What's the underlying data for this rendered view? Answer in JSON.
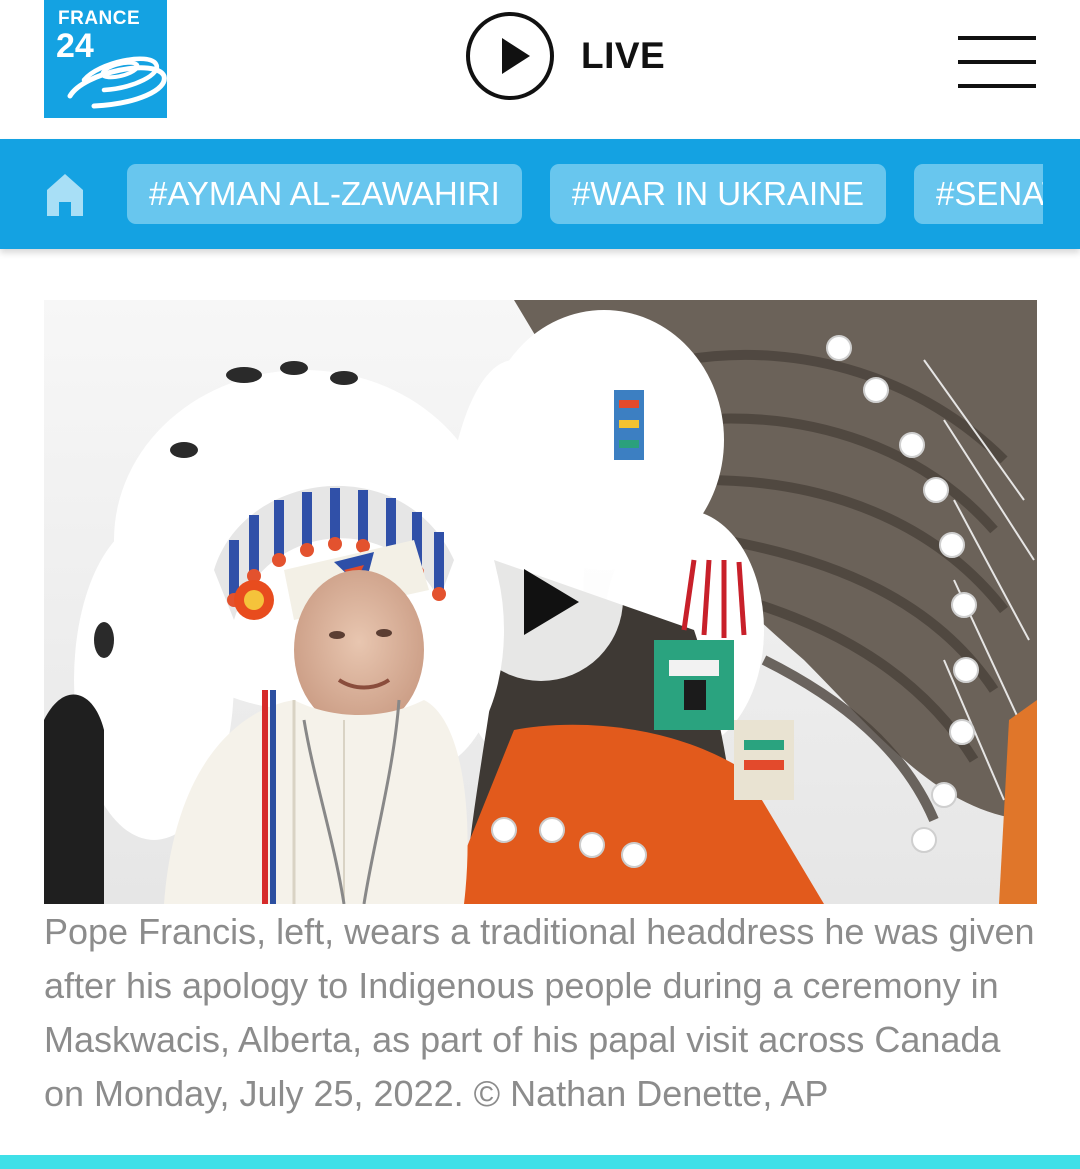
{
  "header": {
    "logo": {
      "name": "FRANCE",
      "number": "24"
    },
    "live_label": "LIVE",
    "menu_icon": "hamburger-menu-icon",
    "colors": {
      "brand": "#14a2e2"
    }
  },
  "tagbar": {
    "home_icon": "home-icon",
    "tags": [
      {
        "label": "#AYMAN AL-ZAWAHIRI"
      },
      {
        "label": "#WAR IN UKRAINE"
      },
      {
        "label": "#SENATE"
      }
    ],
    "colors": {
      "background": "#14a2e2",
      "tag_background": "#68c6ee"
    }
  },
  "media": {
    "play_icon": "play-icon",
    "caption": "Pope Francis, left, wears a traditional headdress he was given after his apology to Indigenous people during a ceremony in Maskwacis, Alberta, as part of his papal visit across Canada on Monday, July 25, 2022. © Nathan Denette, AP"
  }
}
